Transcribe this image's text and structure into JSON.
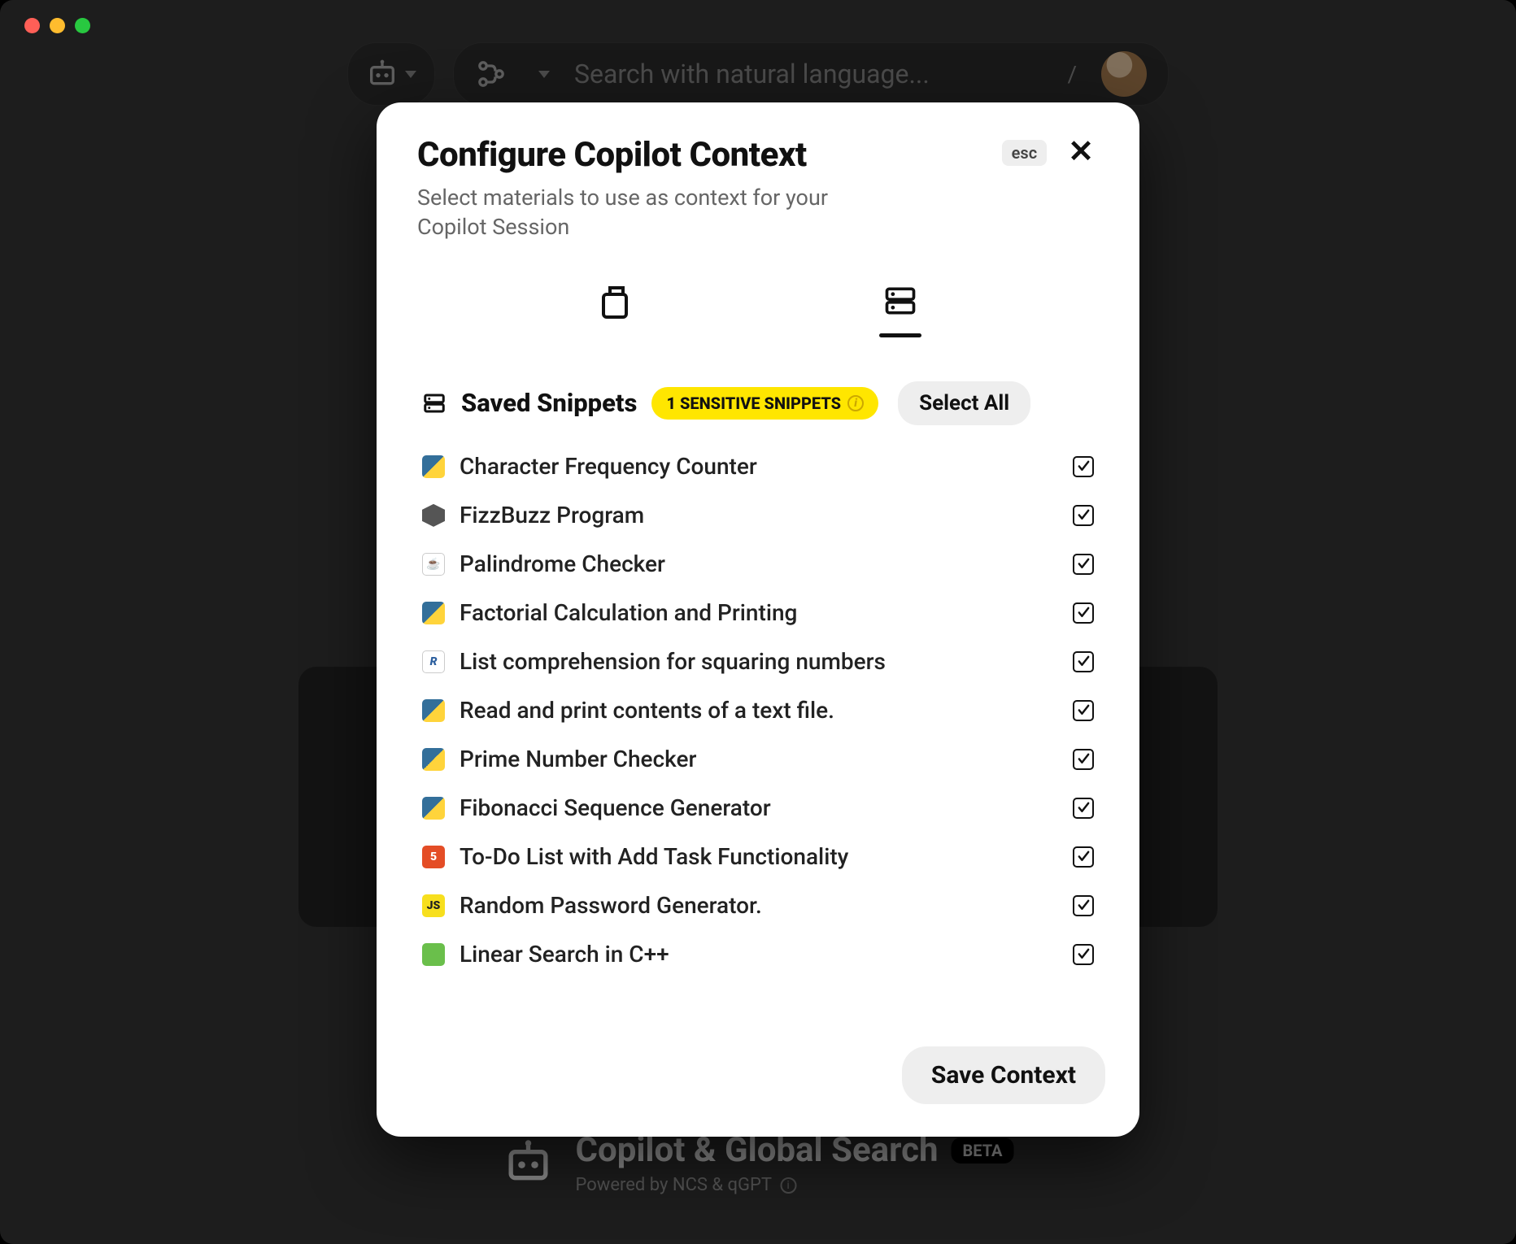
{
  "topbar": {
    "search_placeholder": "Search with natural language...",
    "shortcut": "/"
  },
  "background": {
    "bigtitle": "Copilot & Global Search",
    "badge": "BETA",
    "subtitle": "Powered by NCS & qGPT"
  },
  "modal": {
    "title": "Configure Copilot Context",
    "subtitle": "Select materials to use as context for your Copilot Session",
    "esc": "esc",
    "section_title": "Saved Snippets",
    "sensitive_label": "1 SENSITIVE SNIPPETS",
    "select_all": "Select All",
    "save_label": "Save Context"
  },
  "snippets": [
    {
      "label": "Character Frequency Counter",
      "kind": "py",
      "checked": true
    },
    {
      "label": "FizzBuzz Program",
      "kind": "hex",
      "checked": true
    },
    {
      "label": "Palindrome Checker",
      "kind": "java",
      "checked": true
    },
    {
      "label": "Factorial Calculation and Printing",
      "kind": "py",
      "checked": true
    },
    {
      "label": "List comprehension for squaring numbers",
      "kind": "r",
      "checked": true
    },
    {
      "label": "Read and print contents of a text file.",
      "kind": "py",
      "checked": true
    },
    {
      "label": "Prime Number Checker",
      "kind": "py",
      "checked": true
    },
    {
      "label": "Fibonacci Sequence Generator",
      "kind": "py",
      "checked": true
    },
    {
      "label": "To-Do List with Add Task Functionality",
      "kind": "html",
      "checked": true
    },
    {
      "label": "Random Password Generator.",
      "kind": "js",
      "checked": true
    },
    {
      "label": "Linear Search in C++",
      "kind": "cpp",
      "checked": true
    }
  ]
}
